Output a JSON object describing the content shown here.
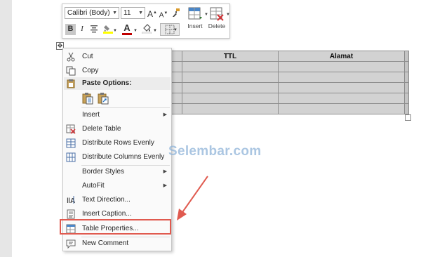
{
  "toolbar": {
    "font_name": "Calibri (Body)",
    "font_size": "11",
    "grow_font": "A",
    "shrink_font": "A",
    "bold": "B",
    "italic": "I",
    "insert_label": "Insert",
    "delete_label": "Delete",
    "colors": {
      "font_color": "#c00000",
      "highlight": "#ffff00"
    },
    "icons": [
      "grow-font-icon",
      "shrink-font-icon",
      "format-painter-icon",
      "align-center-icon",
      "highlight-icon",
      "font-color-icon",
      "shading-icon",
      "borders-icon",
      "insert-table-icon",
      "delete-table-icon"
    ]
  },
  "table": {
    "headers": [
      "",
      "TTL",
      "Alamat",
      ""
    ],
    "rows": [
      [
        "",
        "",
        "",
        ""
      ],
      [
        "",
        "",
        "",
        ""
      ],
      [
        "",
        "",
        "",
        ""
      ],
      [
        "",
        "",
        "",
        ""
      ],
      [
        "",
        "",
        "",
        ""
      ]
    ]
  },
  "context_menu": {
    "cut": "Cut",
    "copy": "Copy",
    "paste_options": "Paste Options:",
    "insert": "Insert",
    "delete_table": "Delete Table",
    "distribute_rows": "Distribute Rows Evenly",
    "distribute_columns": "Distribute Columns Evenly",
    "border_styles": "Border Styles",
    "autofit": "AutoFit",
    "text_direction": "Text Direction...",
    "insert_caption": "Insert Caption...",
    "table_properties": "Table Properties...",
    "new_comment": "New Comment",
    "highlighted_item": "table_properties",
    "highlight_color": "#e05a4f"
  },
  "watermark": "Selembar.com",
  "annotation": {
    "arrow_color": "#e05a4f",
    "target": "table_properties"
  }
}
